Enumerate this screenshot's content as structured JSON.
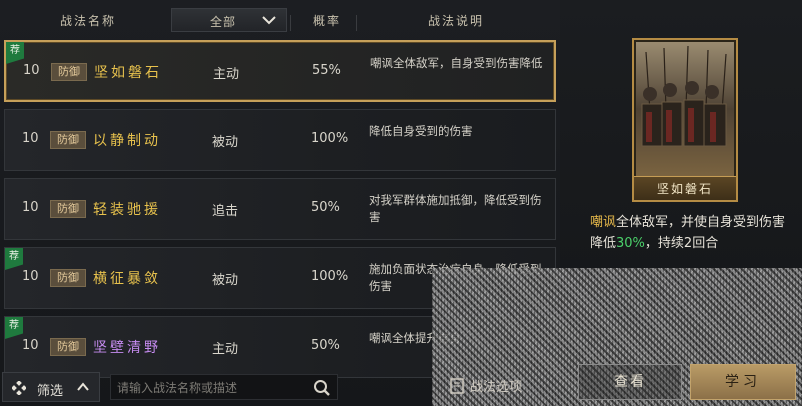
{
  "header": {
    "name_label": "战法名称",
    "filter_value": "全部",
    "rate_label": "概率",
    "desc_label": "战法说明"
  },
  "rows": [
    {
      "recommended": true,
      "rec_label": "荐",
      "level": "10",
      "tag": "防御",
      "name": "坚如磐石",
      "name_color": "yellow",
      "type": "主动",
      "rate": "55%",
      "desc": "嘲讽全体敌军，自身受到伤害降低",
      "selected": true
    },
    {
      "recommended": false,
      "rec_label": "",
      "level": "10",
      "tag": "防御",
      "name": "以静制动",
      "name_color": "yellow",
      "type": "被动",
      "rate": "100%",
      "desc": "降低自身受到的伤害",
      "selected": false
    },
    {
      "recommended": false,
      "rec_label": "",
      "level": "10",
      "tag": "防御",
      "name": "轻装驰援",
      "name_color": "yellow",
      "type": "追击",
      "rate": "50%",
      "desc": "对我军群体施加抵御，降低受到伤害",
      "selected": false
    },
    {
      "recommended": true,
      "rec_label": "荐",
      "level": "10",
      "tag": "防御",
      "name": "横征暴敛",
      "name_color": "yellow",
      "type": "被动",
      "rate": "100%",
      "desc": "施加负面状态治疗自身，降低受到伤害",
      "selected": false
    },
    {
      "recommended": true,
      "rec_label": "荐",
      "level": "10",
      "tag": "防御",
      "name": "坚壁清野",
      "name_color": "purple",
      "type": "主动",
      "rate": "50%",
      "desc": "嘲讽全体提升自身",
      "selected": false
    }
  ],
  "bottom": {
    "filter_label": "筛选",
    "search_placeholder": "请输入战法名称或描述",
    "strategy_label": "战法选项",
    "view_label": "查看",
    "learn_label": "学习"
  },
  "detail": {
    "card_name": "坚如磐石",
    "desc_hl": "嘲讽",
    "desc_part1": "全体敌军，并使自身受到伤害降低",
    "desc_value": "30%",
    "desc_part2": "，持续2回合"
  }
}
